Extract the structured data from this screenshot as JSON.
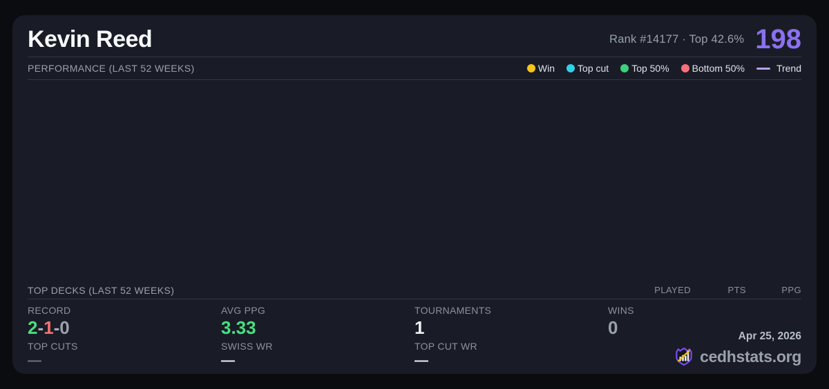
{
  "header": {
    "title": "Kevin Reed",
    "rank_line": "Rank #14177  ·  Top 42.6%",
    "points": "198"
  },
  "performance": {
    "title": "PERFORMANCE (LAST 52 WEEKS)",
    "legend": [
      {
        "label": "Win",
        "color": "#f5c51c"
      },
      {
        "label": "Top cut",
        "color": "#2fd0e8"
      },
      {
        "label": "Top 50%",
        "color": "#3bd27d"
      },
      {
        "label": "Bottom 50%",
        "color": "#f7707a"
      }
    ],
    "trend": {
      "label": "Trend",
      "color": "#b6a3f8"
    },
    "chart_points": []
  },
  "top_decks": {
    "title": "TOP DECKS (LAST 52 WEEKS)",
    "columns": [
      "PLAYED",
      "PTS",
      "PPG"
    ],
    "rows": []
  },
  "stats": {
    "record": {
      "label": "RECORD",
      "wins": "2",
      "losses": "1",
      "draws": "0",
      "separator": "-"
    },
    "avg_ppg": {
      "label": "AVG PPG",
      "value": "3.33"
    },
    "tournaments": {
      "label": "TOURNAMENTS",
      "value": "1"
    },
    "wins": {
      "label": "WINS",
      "value": "0"
    },
    "top_cuts": {
      "label": "TOP CUTS",
      "value": "—"
    },
    "swiss_wr": {
      "label": "SWISS WR",
      "value": "—"
    },
    "top_cut_wr": {
      "label": "TOP CUT WR",
      "value": "—"
    }
  },
  "footer": {
    "date": "Apr 25, 2026",
    "site": "cedhstats.org"
  },
  "colors": {
    "accent_purple": "#8b70f0",
    "win_green": "#4ade80",
    "loss_red": "#f87171",
    "muted_gray": "#9aa1ad",
    "card_bg": "#191c26",
    "page_bg": "#0b0c0f"
  }
}
